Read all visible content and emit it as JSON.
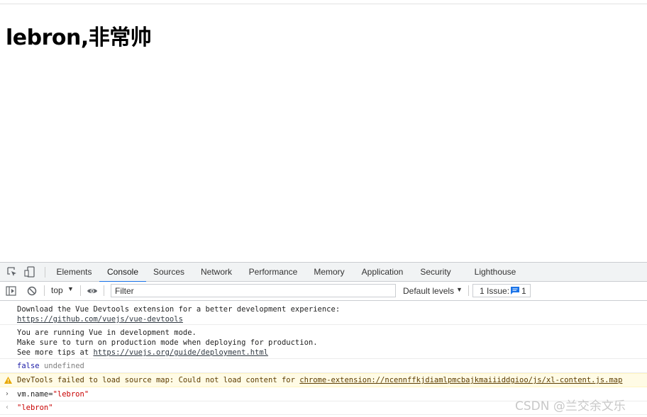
{
  "page": {
    "heading": "lebron,非常帅"
  },
  "devtools": {
    "tabs": [
      {
        "label": "Elements"
      },
      {
        "label": "Console"
      },
      {
        "label": "Sources"
      },
      {
        "label": "Network"
      },
      {
        "label": "Performance"
      },
      {
        "label": "Memory"
      },
      {
        "label": "Application"
      },
      {
        "label": "Security"
      },
      {
        "label": "Lighthouse"
      }
    ],
    "active_tab": "Console",
    "toolbar": {
      "context": "top",
      "filter_placeholder": "Filter",
      "levels": "Default levels",
      "issue_label": "1 Issue:",
      "issue_count": "1"
    },
    "console": {
      "msg1_line1": "Download the Vue Devtools extension for a better development experience:",
      "msg1_link": "https://github.com/vuejs/vue-devtools",
      "msg2_line1": "You are running Vue in development mode.",
      "msg2_line2": "Make sure to turn on production mode when deploying for production.",
      "msg2_prefix": "See more tips at ",
      "msg2_link": "https://vuejs.org/guide/deployment.html",
      "msg3_false": "false",
      "msg3_undefined": "undefined",
      "warn_prefix": "DevTools failed to load source map: Could not load content for ",
      "warn_link": "chrome-extension://ncennffkjdiamlpmcbajkmaiiiddgioo/js/xl-content.js.map",
      "input_code": "vm.name=",
      "input_string": "\"lebron\"",
      "output_string": "\"lebron\""
    }
  },
  "watermark": "CSDN @兰交余文乐",
  "colors": {
    "accent": "#1a73e8",
    "warning_bg": "#fffbe5",
    "string": "#c80000",
    "keyword": "#1a1aa6"
  }
}
